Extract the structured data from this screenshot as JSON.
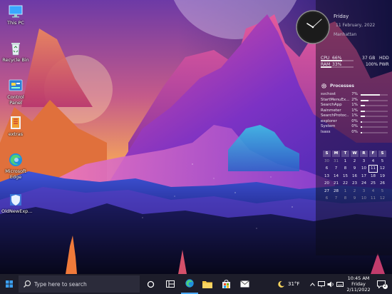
{
  "desktop": {
    "icons": [
      {
        "label": "This PC"
      },
      {
        "label": "Recycle Bin"
      },
      {
        "label": "Control Panel"
      },
      {
        "label": "extras"
      },
      {
        "label": "Microsoft Edge"
      },
      {
        "label": "OldNewExp..."
      }
    ]
  },
  "widgets": {
    "clock": {
      "day": "Friday",
      "date": "11 February, 2022",
      "location": "Manhattan"
    },
    "system": {
      "cpu_label": "CPU",
      "cpu_value": "66%",
      "cpu_fraction": 0.66,
      "ram_label": "RAM",
      "ram_value": "33%",
      "ram_fraction": 0.33,
      "disk_size": "37 GB",
      "disk_label": "HDD",
      "power_value": "100%",
      "power_label": "PWR"
    },
    "processes": {
      "title": "Processes",
      "items": [
        {
          "name": "svchost",
          "pct": "7%",
          "fraction": 0.7
        },
        {
          "name": "StartMenuEx...",
          "pct": "2%",
          "fraction": 0.3
        },
        {
          "name": "SearchApp",
          "pct": "1%",
          "fraction": 0.15
        },
        {
          "name": "Rainmeter",
          "pct": "1%",
          "fraction": 0.15
        },
        {
          "name": "SearchProtoc...",
          "pct": "1%",
          "fraction": 0.15
        },
        {
          "name": "explorer",
          "pct": "0%",
          "fraction": 0.05
        },
        {
          "name": "System",
          "pct": "0%",
          "fraction": 0.05
        },
        {
          "name": "lsass",
          "pct": "0%",
          "fraction": 0.05
        }
      ]
    },
    "calendar": {
      "weekdays": [
        "S",
        "M",
        "T",
        "W",
        "R",
        "F",
        "S"
      ],
      "weeks": [
        [
          {
            "d": "30",
            "o": true
          },
          {
            "d": "31",
            "o": true
          },
          {
            "d": "1"
          },
          {
            "d": "2"
          },
          {
            "d": "3"
          },
          {
            "d": "4"
          },
          {
            "d": "5"
          }
        ],
        [
          {
            "d": "6"
          },
          {
            "d": "7"
          },
          {
            "d": "8"
          },
          {
            "d": "9"
          },
          {
            "d": "10"
          },
          {
            "d": "11",
            "today": true
          },
          {
            "d": "12"
          }
        ],
        [
          {
            "d": "13"
          },
          {
            "d": "14"
          },
          {
            "d": "15"
          },
          {
            "d": "16"
          },
          {
            "d": "17"
          },
          {
            "d": "18"
          },
          {
            "d": "19"
          }
        ],
        [
          {
            "d": "20"
          },
          {
            "d": "21"
          },
          {
            "d": "22"
          },
          {
            "d": "23"
          },
          {
            "d": "24"
          },
          {
            "d": "25"
          },
          {
            "d": "26"
          }
        ],
        [
          {
            "d": "27"
          },
          {
            "d": "28"
          },
          {
            "d": "1",
            "o": true
          },
          {
            "d": "2",
            "o": true
          },
          {
            "d": "3",
            "o": true
          },
          {
            "d": "4",
            "o": true
          },
          {
            "d": "5",
            "o": true
          }
        ],
        [
          {
            "d": "6",
            "o": true
          },
          {
            "d": "7",
            "o": true
          },
          {
            "d": "8",
            "o": true
          },
          {
            "d": "9",
            "o": true
          },
          {
            "d": "10",
            "o": true
          },
          {
            "d": "11",
            "o": true
          },
          {
            "d": "12",
            "o": true
          }
        ]
      ]
    }
  },
  "taskbar": {
    "search_placeholder": "Type here to search",
    "weather": "31°F",
    "time": "10:45 AM",
    "day": "Friday",
    "date": "2/11/2022",
    "notification_count": "2",
    "accent": "#1e90ff"
  }
}
